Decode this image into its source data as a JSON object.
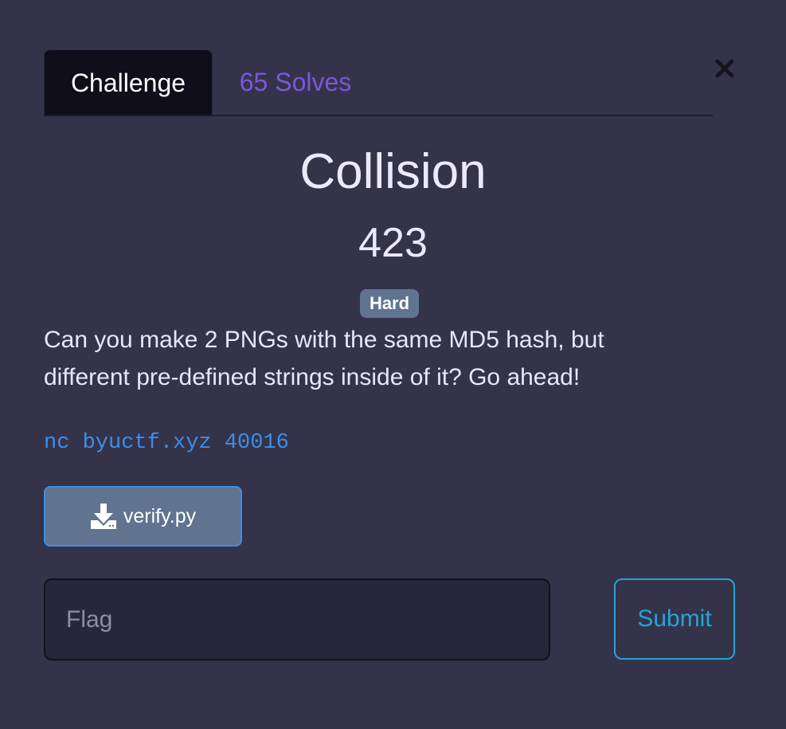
{
  "tabs": {
    "challenge_label": "Challenge",
    "solves_label": "65 Solves"
  },
  "challenge": {
    "name": "Collision",
    "points": "423",
    "difficulty": "Hard",
    "description_line1": "Can you make 2 PNGs with the same MD5 hash, but",
    "description_line2": "different pre-defined strings inside of it? Go ahead!",
    "connection": "nc byuctf.xyz 40016"
  },
  "file": {
    "label": "verify.py",
    "icon": "download-icon"
  },
  "flag_form": {
    "placeholder": "Flag",
    "value": "",
    "submit_label": "Submit"
  },
  "colors": {
    "background": "#34334a",
    "active_tab": "#0f0e1a",
    "solves_tab": "#7a58d8",
    "badge": "#607490",
    "code_link": "#3d8ee8",
    "submit": "#24a3d8"
  }
}
